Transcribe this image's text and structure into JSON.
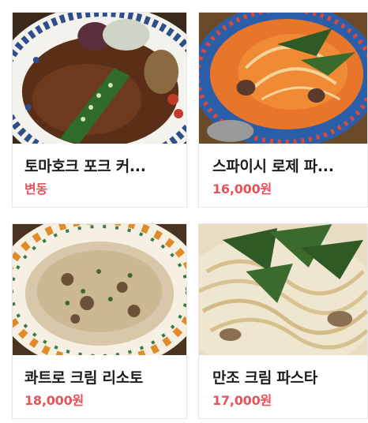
{
  "menu": {
    "items": [
      {
        "name": "토마호크 포크 커...",
        "price": "변동",
        "photo": "tomahawk-pork-cutlet-photo"
      },
      {
        "name": "스파이시 로제 파...",
        "price": "16,000원",
        "photo": "spicy-rose-pasta-photo"
      },
      {
        "name": "콰트로 크림 리소토",
        "price": "18,000원",
        "photo": "quattro-cream-risotto-photo"
      },
      {
        "name": "만조 크림 파스타",
        "price": "17,000원",
        "photo": "manjo-cream-pasta-photo"
      }
    ]
  },
  "colors": {
    "price": "#e8525a",
    "name": "#1d1d1d",
    "card_border": "#e6e6e6"
  }
}
